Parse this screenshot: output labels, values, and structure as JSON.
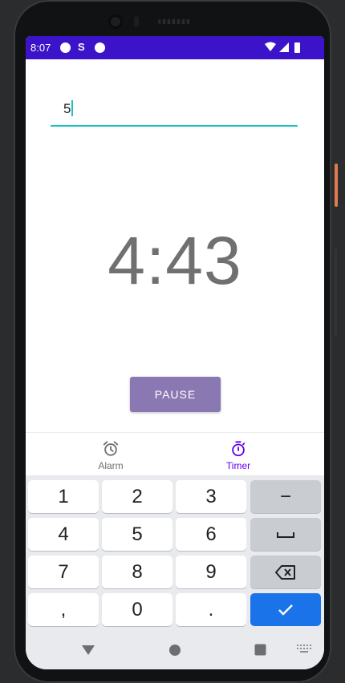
{
  "status_bar": {
    "time": "8:07",
    "s_icon": "S",
    "icons": [
      "circle-icon",
      "s-icon",
      "circle-icon",
      "wifi-icon",
      "signal-icon",
      "battery-icon"
    ]
  },
  "input": {
    "value": "5"
  },
  "timer": {
    "display": "4:43"
  },
  "pause_button": {
    "label": "PAUSE"
  },
  "bottom_nav": {
    "items": [
      {
        "label": "Alarm",
        "icon": "alarm-icon",
        "active": false
      },
      {
        "label": "Timer",
        "icon": "timer-icon",
        "active": true
      }
    ]
  },
  "keyboard": {
    "rows": [
      [
        "1",
        "2",
        "3",
        "−"
      ],
      [
        "4",
        "5",
        "6",
        "space"
      ],
      [
        "7",
        "8",
        "9",
        "backspace"
      ],
      [
        ",",
        "0",
        ".",
        "done"
      ]
    ],
    "labels": {
      "k1": "1",
      "k2": "2",
      "k3": "3",
      "k_minus": "−",
      "k4": "4",
      "k5": "5",
      "k6": "6",
      "k7": "7",
      "k8": "8",
      "k9": "9",
      "k_comma": ",",
      "k0": "0",
      "k_period": "."
    }
  },
  "colors": {
    "status_bar": "#3b14c9",
    "accent": "#19c3c3",
    "button": "#8a78b3",
    "nav_active": "#6200ee",
    "done_key": "#1a73e8"
  }
}
